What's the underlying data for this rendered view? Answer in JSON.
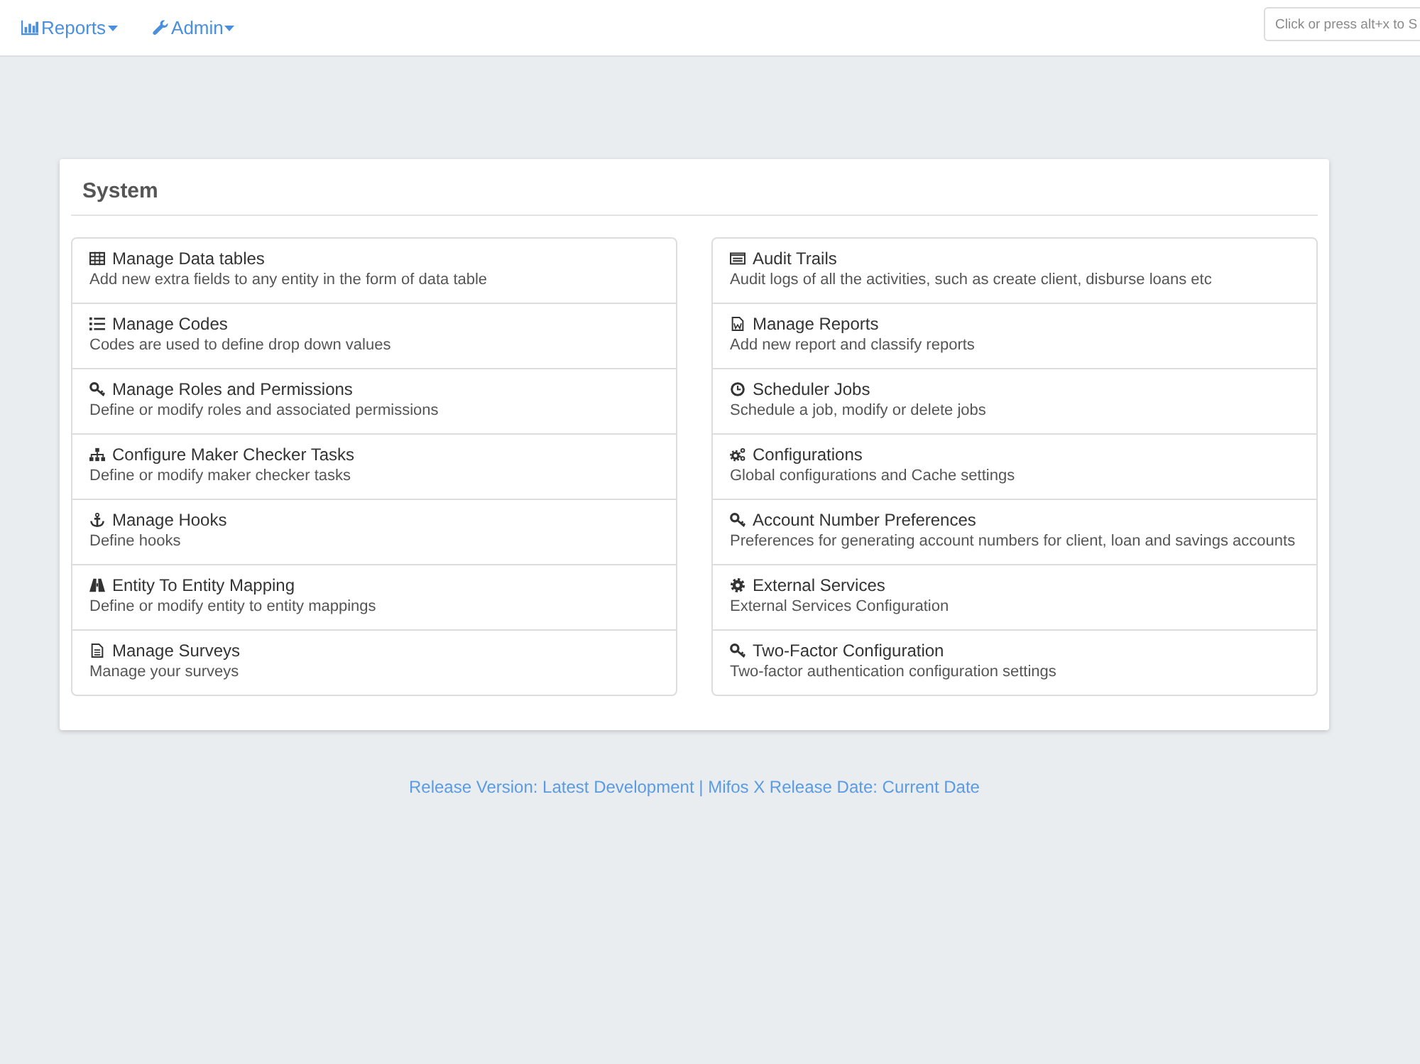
{
  "navbar": {
    "menus": [
      {
        "label": "Reports"
      },
      {
        "label": "Admin"
      }
    ],
    "search": {
      "placeholder": "Click or press alt+x to S"
    }
  },
  "panel": {
    "title": "System",
    "columns": [
      {
        "items": [
          {
            "title": "Manage Data tables",
            "description": "Add new extra fields to any entity in the form of data table"
          },
          {
            "title": "Manage Codes",
            "description": "Codes are used to define drop down values"
          },
          {
            "title": "Manage Roles and Permissions",
            "description": "Define or modify roles and associated permissions"
          },
          {
            "title": "Configure Maker Checker Tasks",
            "description": "Define or modify maker checker tasks"
          },
          {
            "title": "Manage Hooks",
            "description": "Define hooks"
          },
          {
            "title": "Entity To Entity Mapping",
            "description": "Define or modify entity to entity mappings"
          },
          {
            "title": "Manage Surveys",
            "description": "Manage your surveys"
          }
        ]
      },
      {
        "items": [
          {
            "title": "Audit Trails",
            "description": "Audit logs of all the activities, such as create client, disburse loans etc"
          },
          {
            "title": "Manage Reports",
            "description": "Add new report and classify reports"
          },
          {
            "title": "Scheduler Jobs",
            "description": "Schedule a job, modify or delete jobs"
          },
          {
            "title": "Configurations",
            "description": "Global configurations and Cache settings"
          },
          {
            "title": "Account Number Preferences",
            "description": "Preferences for generating account numbers for client, loan and savings accounts"
          },
          {
            "title": "External Services",
            "description": "External Services Configuration"
          },
          {
            "title": "Two-Factor Configuration",
            "description": "Two-factor authentication configuration settings"
          }
        ]
      }
    ]
  },
  "footer": "Release Version: Latest Development | Mifos X Release Date: Current Date"
}
